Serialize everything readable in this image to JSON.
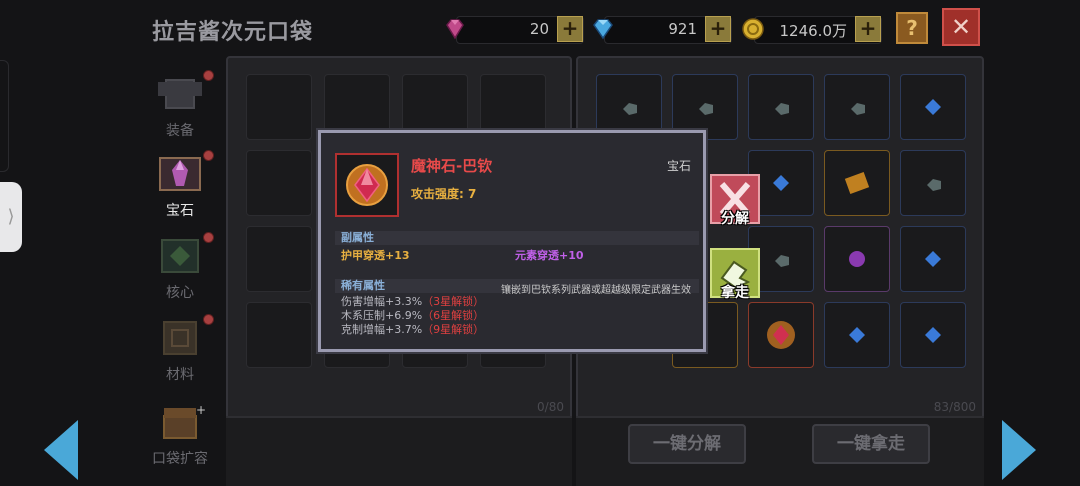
{
  "header": {
    "title": "拉吉酱次元口袋",
    "currencies": [
      {
        "name": "pink-gem",
        "value": "20",
        "color": "#c04a8a"
      },
      {
        "name": "blue-diamond",
        "value": "921",
        "color": "#4aa8e0"
      },
      {
        "name": "gold-coin",
        "value": "1246.0万",
        "color": "#d8b030"
      }
    ],
    "plus_label": "+",
    "help_label": "?",
    "close_label": "✕"
  },
  "sidebar": {
    "items": [
      {
        "label": "装备",
        "icon": "armor-icon",
        "active": false
      },
      {
        "label": "宝石",
        "icon": "gem-icon",
        "active": true
      },
      {
        "label": "核心",
        "icon": "core-icon",
        "active": false
      },
      {
        "label": "材料",
        "icon": "material-icon",
        "active": false
      },
      {
        "label": "口袋扩容",
        "icon": "chest-icon",
        "active": false
      }
    ]
  },
  "left_panel": {
    "count": "0/80"
  },
  "right_panel": {
    "count": "83/800",
    "decompose_all_label": "一键分解",
    "take_all_label": "一键拿走"
  },
  "tooltip": {
    "name": "魔神石-巴钦",
    "type": "宝石",
    "attack": "攻击强度: 7",
    "secondary_header": "副属性",
    "secondary": [
      {
        "text": "护甲穿透+13"
      },
      {
        "text": "元素穿透+10"
      }
    ],
    "rare_header": "稀有属性",
    "rare_note": "镶嵌到巴钦系列武器或超越级限定武器生效",
    "rare": [
      {
        "text": "伤害增幅+3.3%",
        "lock": "（3星解锁）"
      },
      {
        "text": "木系压制+6.9%",
        "lock": "（6星解锁）"
      },
      {
        "text": "克制增幅+3.7%",
        "lock": "（9星解锁）"
      }
    ]
  },
  "actions": {
    "decompose_label": "分解",
    "take_label": "拿走"
  },
  "colors": {
    "accent_arrow": "#4aa8d8",
    "name_red": "#e84a4a",
    "attr_orange": "#e8b040",
    "attr_purple": "#c060e8"
  }
}
